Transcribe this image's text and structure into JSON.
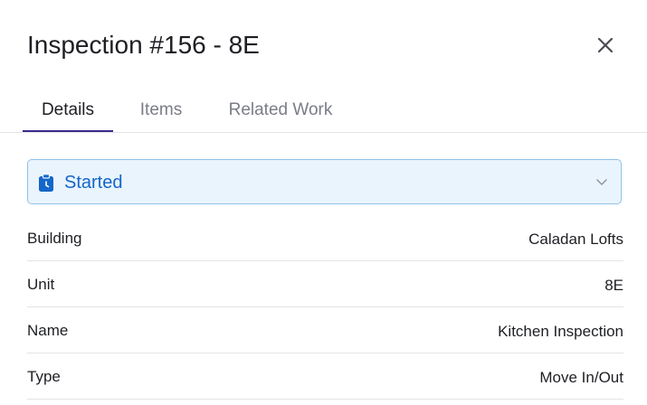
{
  "dialog": {
    "title": "Inspection #156 - 8E",
    "close_icon": "close-icon"
  },
  "tabs": [
    {
      "label": "Details",
      "active": true
    },
    {
      "label": "Items",
      "active": false
    },
    {
      "label": "Related Work",
      "active": false
    }
  ],
  "status": {
    "value": "Started",
    "icon": "clipboard-clock-icon",
    "dropdown_icon": "chevron-down-icon",
    "color": "#1466c9",
    "background": "#eaf4fd"
  },
  "fields": [
    {
      "label": "Building",
      "value": "Caladan Lofts"
    },
    {
      "label": "Unit",
      "value": "8E"
    },
    {
      "label": "Name",
      "value": "Kitchen Inspection"
    },
    {
      "label": "Type",
      "value": "Move In/Out"
    }
  ],
  "colors": {
    "active_tab_underline": "#3d2a8c",
    "divider": "#e3e4e8"
  }
}
